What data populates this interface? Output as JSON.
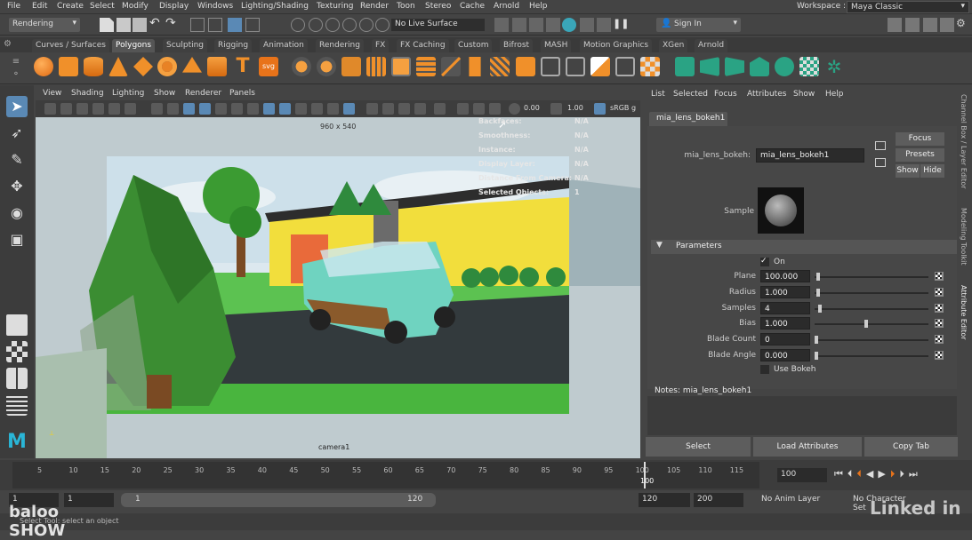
{
  "menubar": {
    "items": [
      "File",
      "Edit",
      "Create",
      "Select",
      "Modify",
      "Display",
      "Windows",
      "Lighting/Shading",
      "Texturing",
      "Render",
      "Toon",
      "Stereo",
      "Cache",
      "Arnold",
      "Help"
    ],
    "workspace_label": "Workspace :",
    "workspace_value": "Maya Classic"
  },
  "statusline": {
    "mode": "Rendering",
    "live_surface": "No Live Surface",
    "sign_in": "Sign In"
  },
  "shelf": {
    "tabs": [
      "Curves / Surfaces",
      "Polygons",
      "Sculpting",
      "Rigging",
      "Animation",
      "Rendering",
      "FX",
      "FX Caching",
      "Custom",
      "Bifrost",
      "MASH",
      "Motion Graphics",
      "XGen",
      "Arnold"
    ],
    "active_tab": "Polygons",
    "text_icon": "T",
    "svg_icon": "svg"
  },
  "viewport": {
    "menu": [
      "View",
      "Shading",
      "Lighting",
      "Show",
      "Renderer",
      "Panels"
    ],
    "exposure": "0.00",
    "gamma": "1.00",
    "color_space": "sRGB g",
    "resolution": "960 x 540",
    "camera": "camera1",
    "hud": [
      {
        "label": "Backfaces:",
        "value": "N/A"
      },
      {
        "label": "Smoothness:",
        "value": "N/A"
      },
      {
        "label": "Instance:",
        "value": "N/A"
      },
      {
        "label": "Display Layer:",
        "value": "N/A"
      },
      {
        "label": "Distance From Camera:",
        "value": "N/A"
      },
      {
        "label": "Selected Objects:",
        "value": "1"
      }
    ]
  },
  "attribute_editor": {
    "menu": [
      "List",
      "Selected",
      "Focus",
      "Attributes",
      "Show",
      "Help"
    ],
    "tab": "mia_lens_bokeh1",
    "node_label": "mia_lens_bokeh:",
    "node_value": "mia_lens_bokeh1",
    "focus_btn": "Focus",
    "presets_btn": "Presets",
    "show_btn": "Show",
    "hide_btn": "Hide",
    "sample_label": "Sample",
    "section": "Parameters",
    "on_label": "On",
    "params": [
      {
        "label": "Plane",
        "value": "100.000",
        "level": 0.02
      },
      {
        "label": "Radius",
        "value": "1.000",
        "level": 0.02
      },
      {
        "label": "Samples",
        "value": "4",
        "level": 0.03
      },
      {
        "label": "Bias",
        "value": "1.000",
        "level": 0.45
      },
      {
        "label": "Blade Count",
        "value": "0",
        "level": 0.0
      },
      {
        "label": "Blade Angle",
        "value": "0.000",
        "level": 0.0
      }
    ],
    "use_bokeh": "Use Bokeh",
    "notes_label": "Notes:  mia_lens_bokeh1",
    "buttons": [
      "Select",
      "Load Attributes",
      "Copy Tab"
    ],
    "side_tabs": [
      "Channel Box / Layer Editor",
      "Modeling Toolkit",
      "Attribute Editor"
    ]
  },
  "timeline": {
    "ticks": [
      "5",
      "10",
      "15",
      "20",
      "25",
      "30",
      "35",
      "40",
      "45",
      "50",
      "55",
      "60",
      "65",
      "70",
      "75",
      "80",
      "85",
      "90",
      "95",
      "100",
      "105",
      "110",
      "115"
    ],
    "current_frame": "100",
    "frame_field": "100"
  },
  "range": {
    "start": "1",
    "start2": "1",
    "slider_start": "1",
    "slider_end": "120",
    "end": "120",
    "end2": "200",
    "anim_layer": "No Anim Layer",
    "char_set": "No Character Set"
  },
  "helpline": "Select Tool: select an object",
  "watermarks": [
    "baloo SHOW",
    "Linked in"
  ]
}
